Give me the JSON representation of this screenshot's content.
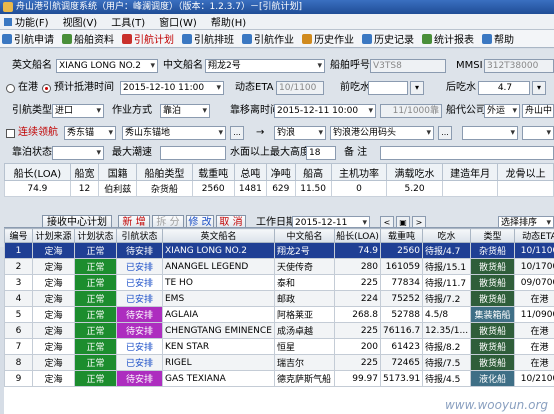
{
  "window": {
    "title": "舟山港引航调度系统（用户：峰澜调度）（版本：1.2.3.7）－[引航计划]"
  },
  "menu": [
    "功能(F)",
    "视图(V)",
    "工具(T)",
    "窗口(W)",
    "帮助(H)"
  ],
  "toolbar": [
    {
      "label": "引航申请",
      "icon": "pilot-request-icon",
      "color": "#3b78c2"
    },
    {
      "label": "船舶资料",
      "icon": "ship-data-icon",
      "color": "#4a8f3a"
    },
    {
      "label": "引航计划",
      "icon": "pilot-plan-icon",
      "color": "#c9302c"
    },
    {
      "label": "引航排班",
      "icon": "schedule-icon",
      "color": "#3b78c2"
    },
    {
      "label": "引航作业",
      "icon": "operation-icon",
      "color": "#3b78c2"
    },
    {
      "label": "历史作业",
      "icon": "history-op-icon",
      "color": "#d08a1e"
    },
    {
      "label": "历史记录",
      "icon": "history-record-icon",
      "color": "#3b78c2"
    },
    {
      "label": "统计报表",
      "icon": "report-icon",
      "color": "#4a8f3a"
    },
    {
      "label": "帮助",
      "icon": "help-icon",
      "color": "#3b78c2"
    }
  ],
  "form": {
    "en_name_label": "英文船名",
    "en_name": "XIANG LONG NO.2",
    "cn_name_label": "中文船名",
    "cn_name": "翔龙2号",
    "callsign_label": "船舶呼号",
    "callsign": "V3TS8",
    "mmsi_label": "MMSI",
    "mmsi": "312T38000",
    "radio_in_port": "在港",
    "radio_eta": "预计抵港时间",
    "eta_datetime": "2015-12-10 11:00",
    "dyn_eta_label": "动态ETA",
    "dyn_eta": "10/1100",
    "draft_front_label": "前吃水",
    "draft_back_label": "后吃水",
    "draft_back": "4.7",
    "pilot_type_label": "引航类型",
    "pilot_type": "进口",
    "op_mode_label": "作业方式",
    "op_mode": "靠泊",
    "berth_time_label": "靠移离时间",
    "berth_time": "2015-12-11 10:00",
    "berth_time_code": "11/1000靠",
    "agent_label": "船代公司",
    "agent": "外运",
    "agent_name": "舟山中",
    "escort_label": "连续领航",
    "from_anchor": "秀东锚",
    "from_place": "秀山东锚地",
    "to_short": "钓浪",
    "to_place": "钓浪港公用码头",
    "berth_status_label": "靠泊状态",
    "max_speed_label": "最大潮速",
    "height_label": "水面以上最大高度",
    "height": "18",
    "remark_label": "备  注"
  },
  "ship_grid": {
    "headers": [
      "船长(LOA)",
      "船宽",
      "国籍",
      "船舶类型",
      "载重吨",
      "总吨",
      "净吨",
      "船高",
      "主机功率",
      "满载吃水",
      "建造年月",
      "龙骨以上"
    ],
    "values": [
      "74.9",
      "12",
      "伯利兹",
      "杂货船",
      "2560",
      "1481",
      "629",
      "11.50",
      "0",
      "5.20",
      "",
      ""
    ]
  },
  "actions": {
    "receive": "接收中心计划",
    "add": "新  增",
    "split": "拆  分",
    "edit": "修  改",
    "cancel": "取  消",
    "workdate_label": "工作日期",
    "workdate": "2015-12-11",
    "sort": "选择排序"
  },
  "table": {
    "headers": [
      "编号",
      "计划来源",
      "计划状态",
      "引航状态",
      "英文船名",
      "中文船名",
      "船长(LOA)",
      "载重吨",
      "吃水",
      "类型",
      "动态ETA"
    ],
    "rows": [
      [
        "1",
        "定海",
        "正常",
        "待安排",
        "XIANG LONG NO.2",
        "翔龙2号",
        "74.9",
        "2560",
        "待报/4.7",
        "杂货船",
        "10/1100"
      ],
      [
        "2",
        "定海",
        "正常",
        "已安排",
        "ANANGEL LEGEND",
        "天使传奇",
        "280",
        "161059",
        "待报/15.1",
        "散货船",
        "10/1700"
      ],
      [
        "3",
        "定海",
        "正常",
        "已安排",
        "TE HO",
        "泰和",
        "225",
        "77834",
        "待报/11.7",
        "散货船",
        "09/0700"
      ],
      [
        "4",
        "定海",
        "正常",
        "已安排",
        "EMS",
        "邮政",
        "224",
        "75252",
        "待报/7.2",
        "散货船",
        "在港"
      ],
      [
        "5",
        "定海",
        "正常",
        "待安排",
        "AGLAIA",
        "阿格莱亚",
        "268.8",
        "52788",
        "4.5/8",
        "集装箱船",
        "11/0900"
      ],
      [
        "6",
        "定海",
        "正常",
        "待安排",
        "CHENGTANG EMINENCE",
        "成汤卓越",
        "225",
        "76116.7",
        "12.35/1...",
        "散货船",
        "在港"
      ],
      [
        "7",
        "定海",
        "正常",
        "已安排",
        "KEN STAR",
        "恒星",
        "200",
        "61423",
        "待报/8.2",
        "散货船",
        "在港"
      ],
      [
        "8",
        "定海",
        "正常",
        "已安排",
        "RIGEL",
        "瑞吉尔",
        "225",
        "72465",
        "待报/7.5",
        "散货船",
        "在港"
      ],
      [
        "9",
        "定海",
        "正常",
        "待安排",
        "GAS TEXIANA",
        "德克萨斯气船",
        "99.97",
        "5173.91",
        "待报/4.5",
        "液化船",
        "10/2100"
      ]
    ]
  },
  "watermark": "www.wooyun.org"
}
